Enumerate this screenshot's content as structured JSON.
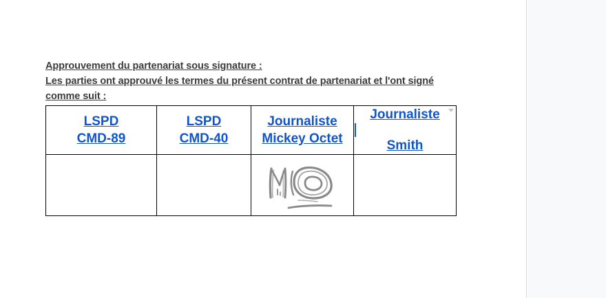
{
  "document": {
    "heading_lines": [
      "Approuvement du partenariat sous signature :",
      "Les parties ont approuvé les termes du présent contrat de partenariat et l'ont signé",
      "comme suit :"
    ],
    "table": {
      "columns": [
        {
          "line1": "LSPD",
          "line2": "CMD-89"
        },
        {
          "line1": "LSPD",
          "line2": "CMD-40"
        },
        {
          "line1": "Journaliste",
          "line2": "Mickey Octet"
        },
        {
          "line1": "Journaliste",
          "line2": "Smith"
        }
      ],
      "signature_present": [
        false,
        false,
        true,
        false
      ]
    }
  },
  "colors": {
    "link_blue": "#1155cc",
    "heading_text": "#3c3c3c",
    "signature_ink": "#8a8a8a",
    "gutter_bg": "#f8f9fa"
  },
  "icons": {
    "cell_menu": "dropdown-triangle-icon",
    "text_cursor": "caret"
  }
}
